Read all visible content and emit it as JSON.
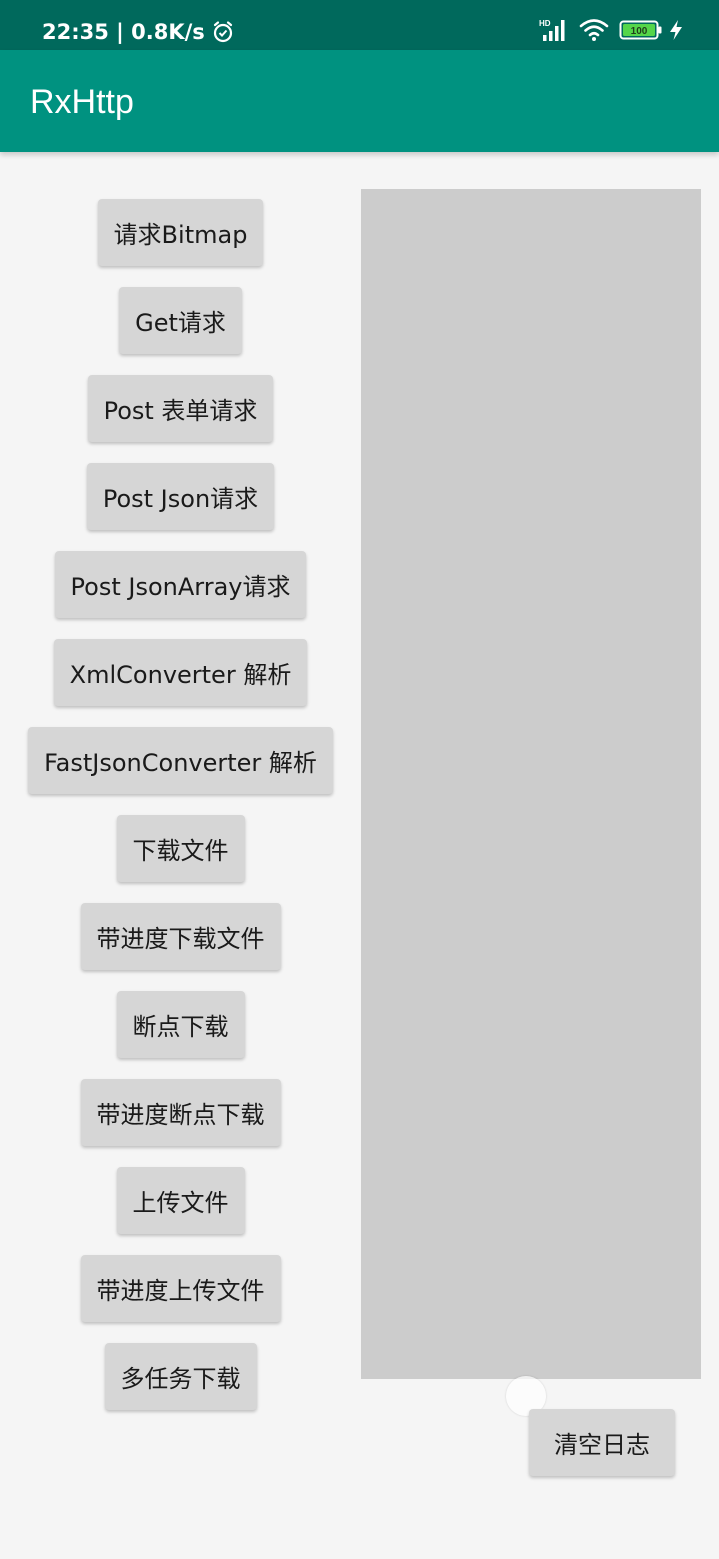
{
  "status_bar": {
    "time_speed": "22:35 | 0.8K/s",
    "signal_label": "HD",
    "battery_level": "100",
    "icons": [
      "alarm-icon",
      "signal-icon",
      "wifi-icon",
      "battery-icon",
      "charging-icon"
    ]
  },
  "app_bar": {
    "title": "RxHttp"
  },
  "actions": {
    "items": [
      {
        "label": "请求Bitmap"
      },
      {
        "label": "Get请求"
      },
      {
        "label": "Post 表单请求"
      },
      {
        "label": "Post Json请求"
      },
      {
        "label": "Post JsonArray请求"
      },
      {
        "label": "XmlConverter 解析"
      },
      {
        "label": "FastJsonConverter 解析"
      },
      {
        "label": "下载文件"
      },
      {
        "label": "带进度下载文件"
      },
      {
        "label": "断点下载"
      },
      {
        "label": "带进度断点下载"
      },
      {
        "label": "上传文件"
      },
      {
        "label": "带进度上传文件"
      },
      {
        "label": "多任务下载"
      }
    ]
  },
  "log": {
    "text": "",
    "clear_label": "清空日志"
  },
  "colors": {
    "status_bar": "#00695c",
    "app_bar": "#009280",
    "button": "#d6d6d6",
    "log_panel": "#cccccc"
  }
}
